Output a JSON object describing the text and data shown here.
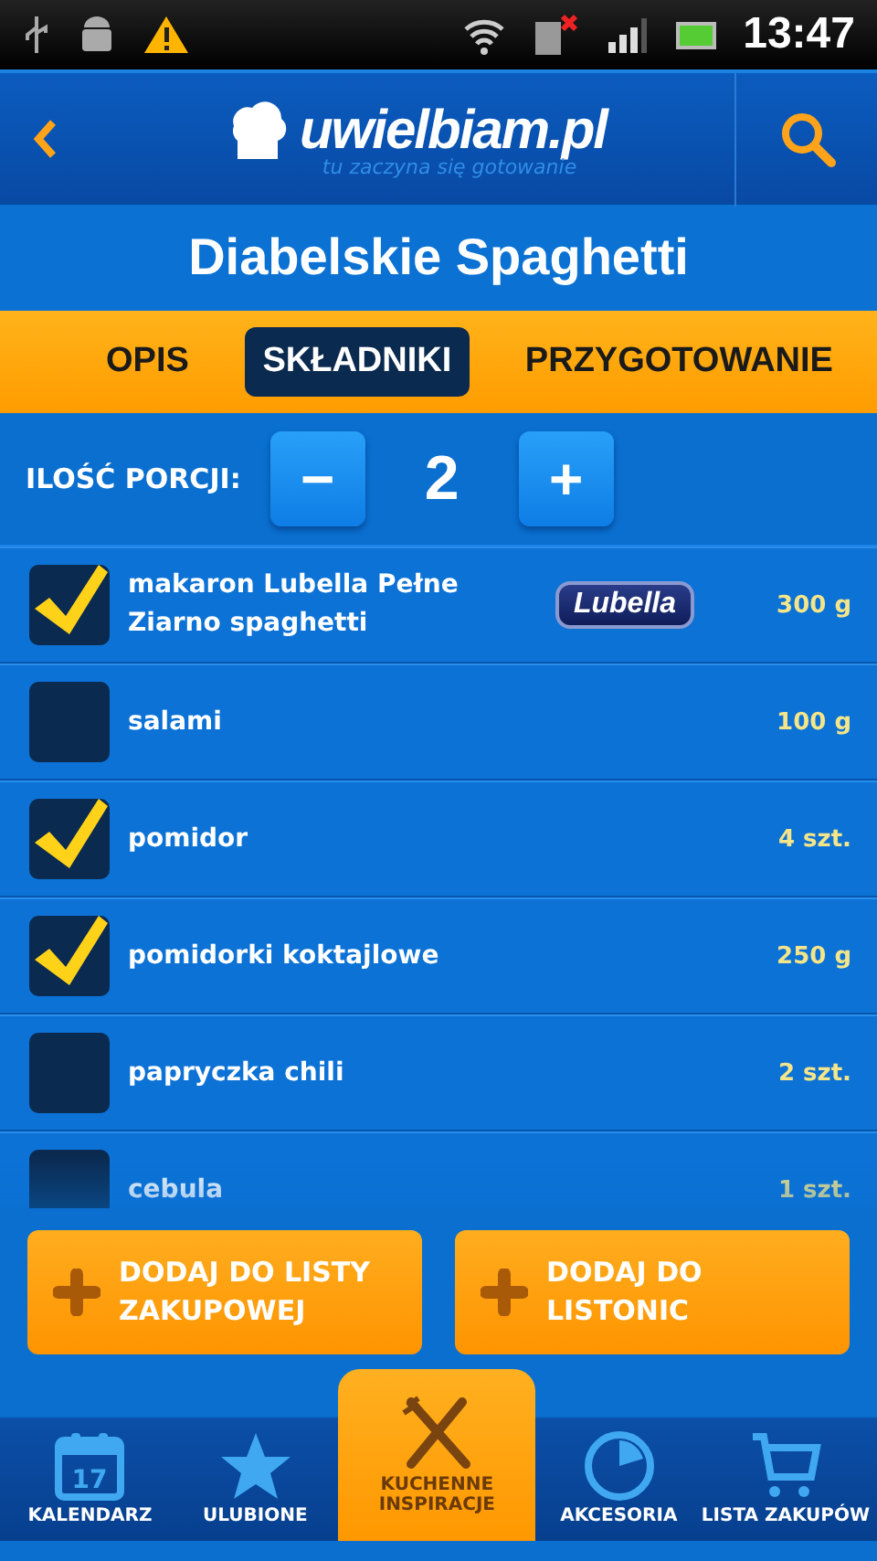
{
  "status_bar": {
    "time": "13:47"
  },
  "header": {
    "logo": "uwielbiam.pl",
    "tagline": "tu zaczyna się gotowanie"
  },
  "title": "Diabelskie Spaghetti",
  "tabs": [
    {
      "label": "OPIS",
      "selected": false
    },
    {
      "label": "SKŁADNIKI",
      "selected": true
    },
    {
      "label": "PRZYGOTOWANIE",
      "selected": false
    }
  ],
  "portions": {
    "label": "ILOŚĆ PORCJI:",
    "minus": "−",
    "value": "2",
    "plus": "+"
  },
  "ingredients": [
    {
      "name": "makaron Lubella Pełne Ziarno spaghetti",
      "brand": "Lubella",
      "amount": "300 g",
      "checked": true
    },
    {
      "name": "salami",
      "amount": "100 g",
      "checked": false
    },
    {
      "name": "pomidor",
      "amount": "4 szt.",
      "checked": true
    },
    {
      "name": "pomidorki koktajlowe",
      "amount": "250 g",
      "checked": true
    },
    {
      "name": "papryczka chili",
      "amount": "2 szt.",
      "checked": false
    },
    {
      "name": "cebula",
      "amount": "1 szt.",
      "checked": false
    }
  ],
  "actions": [
    {
      "label": "DODAJ DO LISTY ZAKUPOWEJ"
    },
    {
      "label": "DODAJ DO LISTONIC"
    }
  ],
  "nav": [
    {
      "kind": "calendar",
      "label": "KALENDARZ",
      "icon_text": "17",
      "selected": false
    },
    {
      "kind": "star",
      "label": "ULUBIONE",
      "selected": false
    },
    {
      "kind": "cutlery",
      "label": "KUCHENNE INSPIRACJE",
      "selected": true
    },
    {
      "kind": "timer",
      "label": "AKCESORIA",
      "selected": false
    },
    {
      "kind": "cart",
      "label": "LISTA ZAKUPÓW",
      "selected": false
    }
  ]
}
